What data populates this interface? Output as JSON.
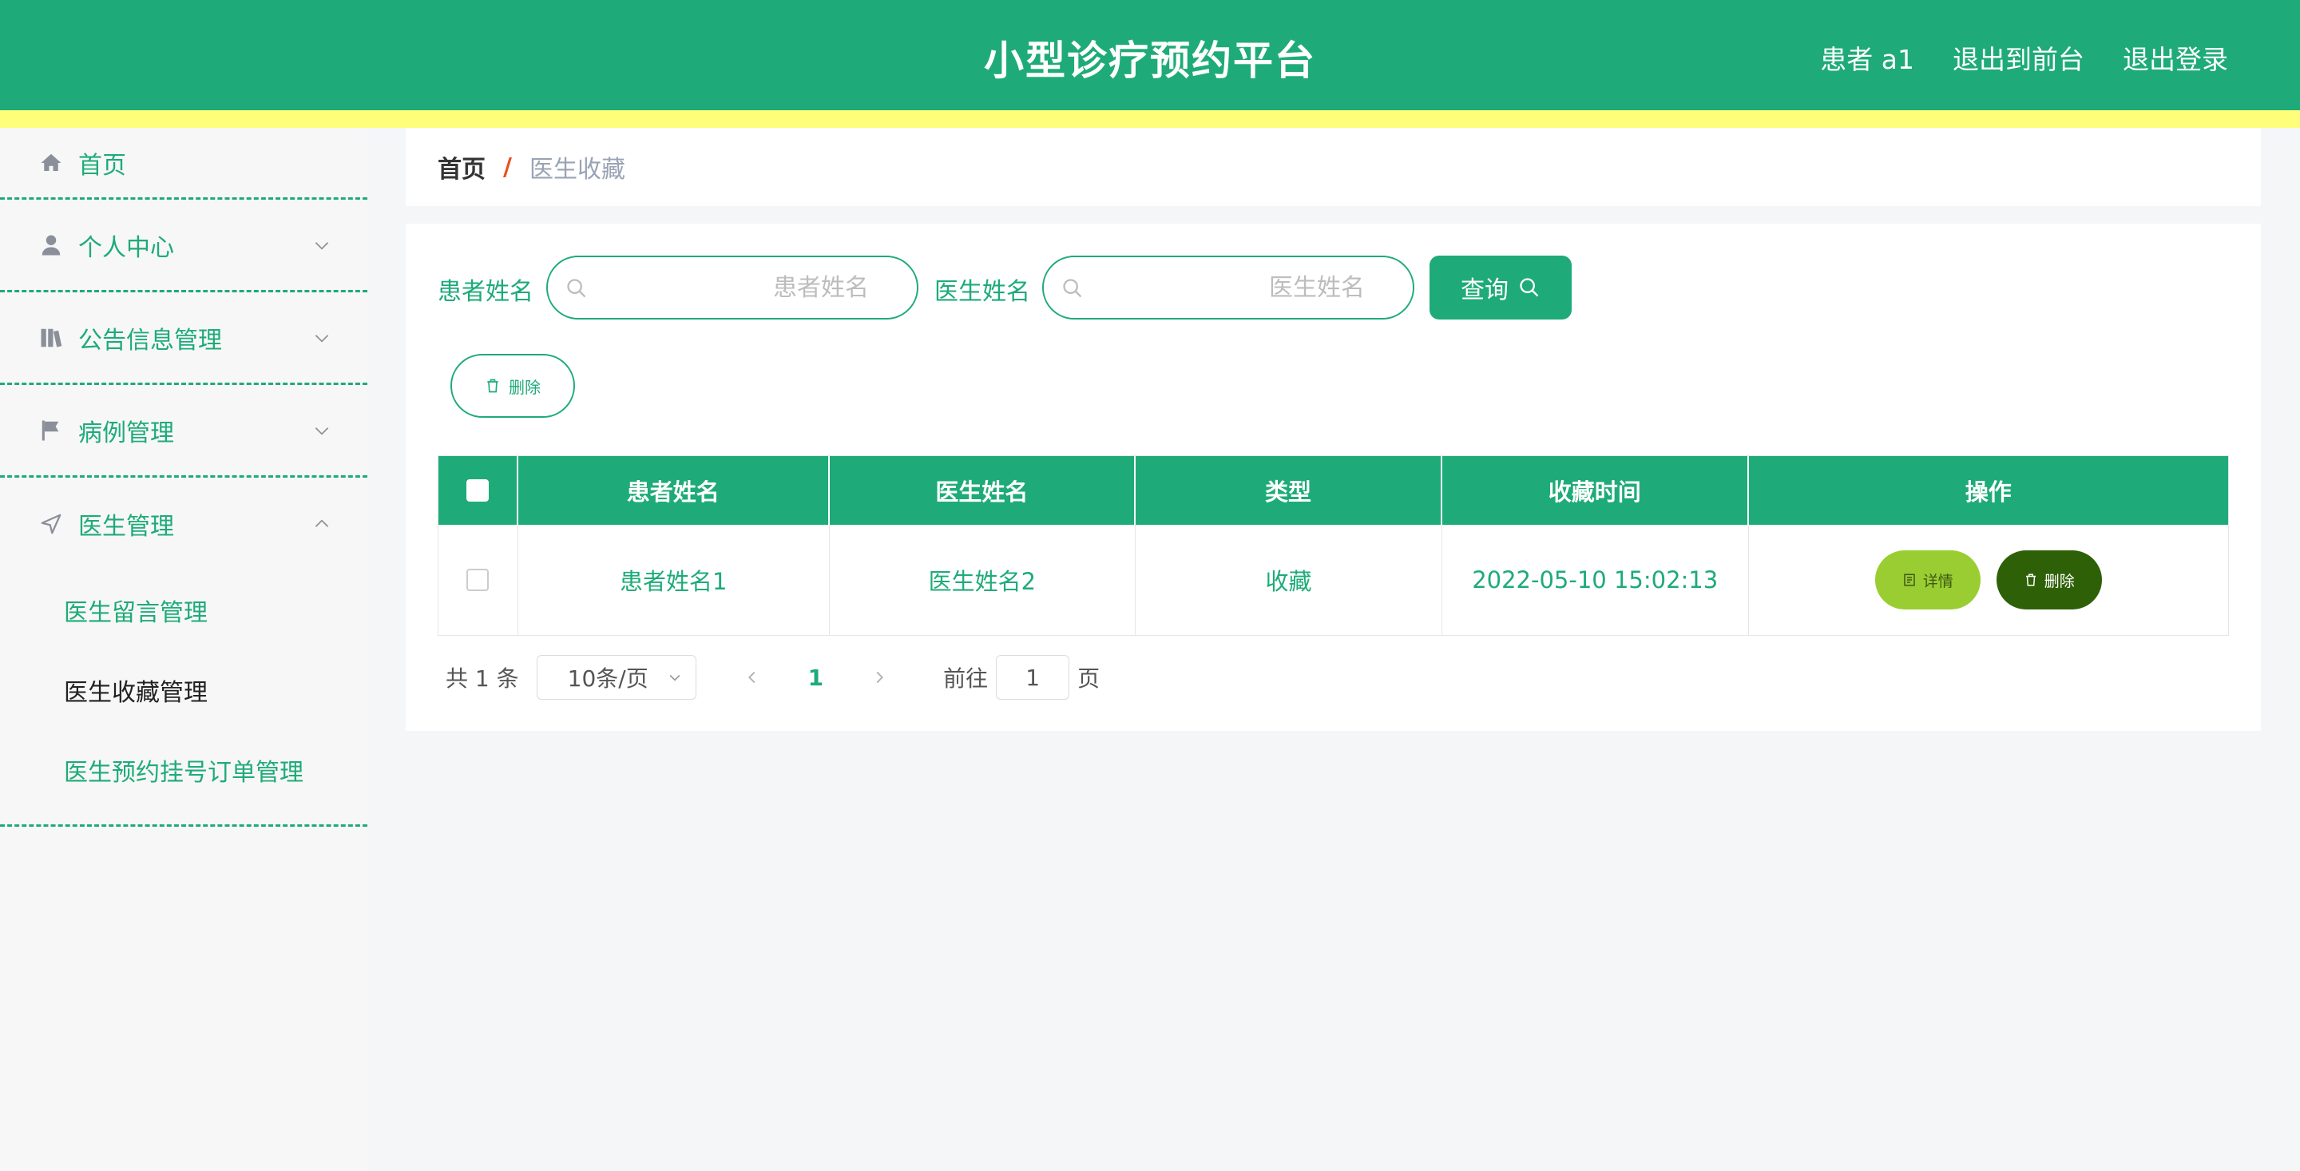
{
  "header": {
    "title": "小型诊疗预约平台",
    "user_label": "患者 a1",
    "to_front_label": "退出到前台",
    "logout_label": "退出登录"
  },
  "sidebar": {
    "items": [
      {
        "label": "首页",
        "icon": "home-icon"
      },
      {
        "label": "个人中心",
        "icon": "user-icon"
      },
      {
        "label": "公告信息管理",
        "icon": "book-icon"
      },
      {
        "label": "病例管理",
        "icon": "flag-icon"
      },
      {
        "label": "医生管理",
        "icon": "navigation-icon"
      }
    ],
    "subitems": [
      {
        "label": "医生留言管理"
      },
      {
        "label": "医生收藏管理"
      },
      {
        "label": "医生预约挂号订单管理"
      }
    ]
  },
  "breadcrumb": {
    "home": "首页",
    "sep": "/",
    "current": "医生收藏"
  },
  "filter": {
    "patient_label": "患者姓名",
    "patient_placeholder": "患者姓名",
    "doctor_label": "医生姓名",
    "doctor_placeholder": "医生姓名",
    "query_label": "查询",
    "delete_label": "删除"
  },
  "table": {
    "headers": [
      "患者姓名",
      "医生姓名",
      "类型",
      "收藏时间",
      "操作"
    ],
    "rows": [
      {
        "patient": "患者姓名1",
        "doctor": "医生姓名2",
        "type": "收藏",
        "time": "2022-05-10 15:02:13",
        "detail_label": "详情",
        "delete_label": "删除"
      }
    ]
  },
  "pagination": {
    "total_text": "共 1 条",
    "page_size": "10条/页",
    "current_page": "1",
    "goto_label": "前往",
    "goto_value": "1",
    "page_suffix": "页"
  },
  "colors": {
    "primary": "#1eab79",
    "accent_bar": "#fefe7a",
    "detail_btn": "#9acd32",
    "delete_btn": "#2e6007",
    "breadcrumb_sep": "#e9501f"
  }
}
